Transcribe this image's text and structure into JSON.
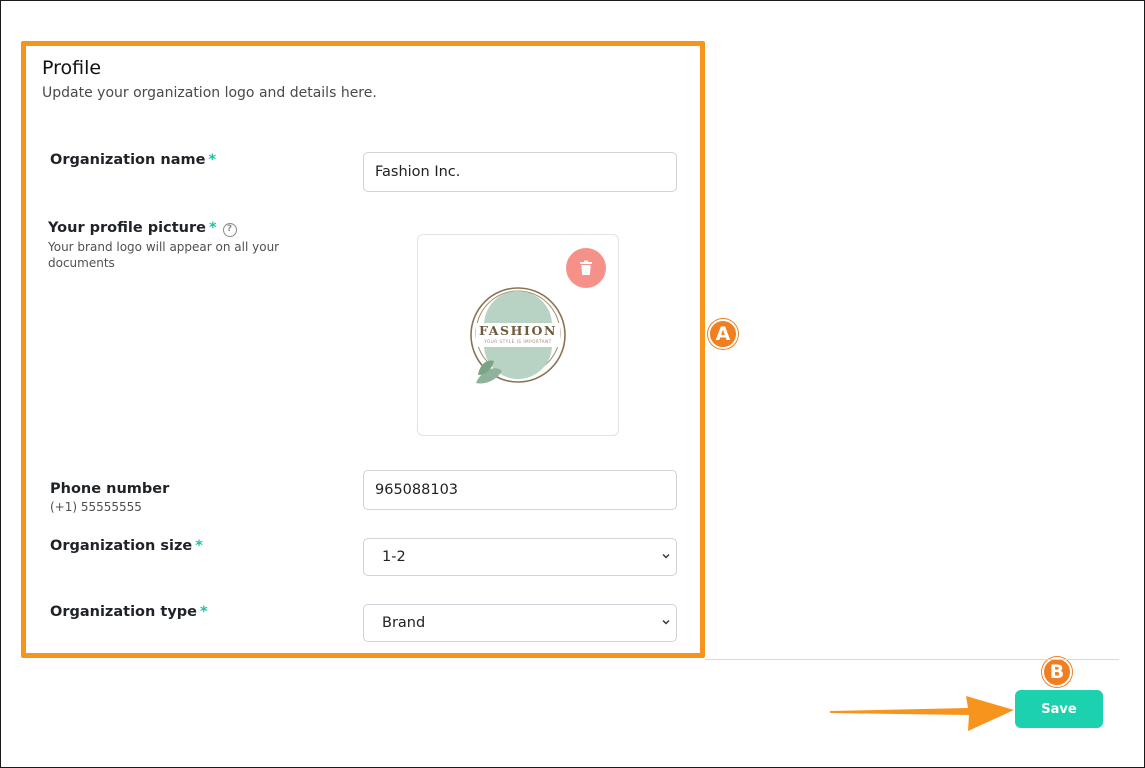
{
  "profile": {
    "title": "Profile",
    "subtitle": "Update your organization logo and details here."
  },
  "fields": {
    "org_name": {
      "label": "Organization name",
      "required": "*",
      "value": "Fashion Inc."
    },
    "profile_picture": {
      "label": "Your profile picture",
      "required": "*",
      "help_icon": "question-circle-icon",
      "hint": "Your brand logo will appear on all your documents",
      "logo_text": "FASHION",
      "logo_tagline": "YOUR STYLE IS IMPORTANT",
      "delete_icon": "trash-icon"
    },
    "phone": {
      "label": "Phone number",
      "hint": "(+1) 55555555",
      "value": "965088103"
    },
    "org_size": {
      "label": "Organization size",
      "required": "*",
      "value": "1-2"
    },
    "org_type": {
      "label": "Organization type",
      "required": "*",
      "value": "Brand"
    }
  },
  "actions": {
    "save_label": "Save"
  },
  "annotations": {
    "a": "A",
    "b": "B"
  },
  "colors": {
    "highlight": "#f7941d",
    "marker": "#f07f22",
    "accent": "#1bd1ae",
    "required": "#19c3a5",
    "delete": "#f6918a"
  }
}
